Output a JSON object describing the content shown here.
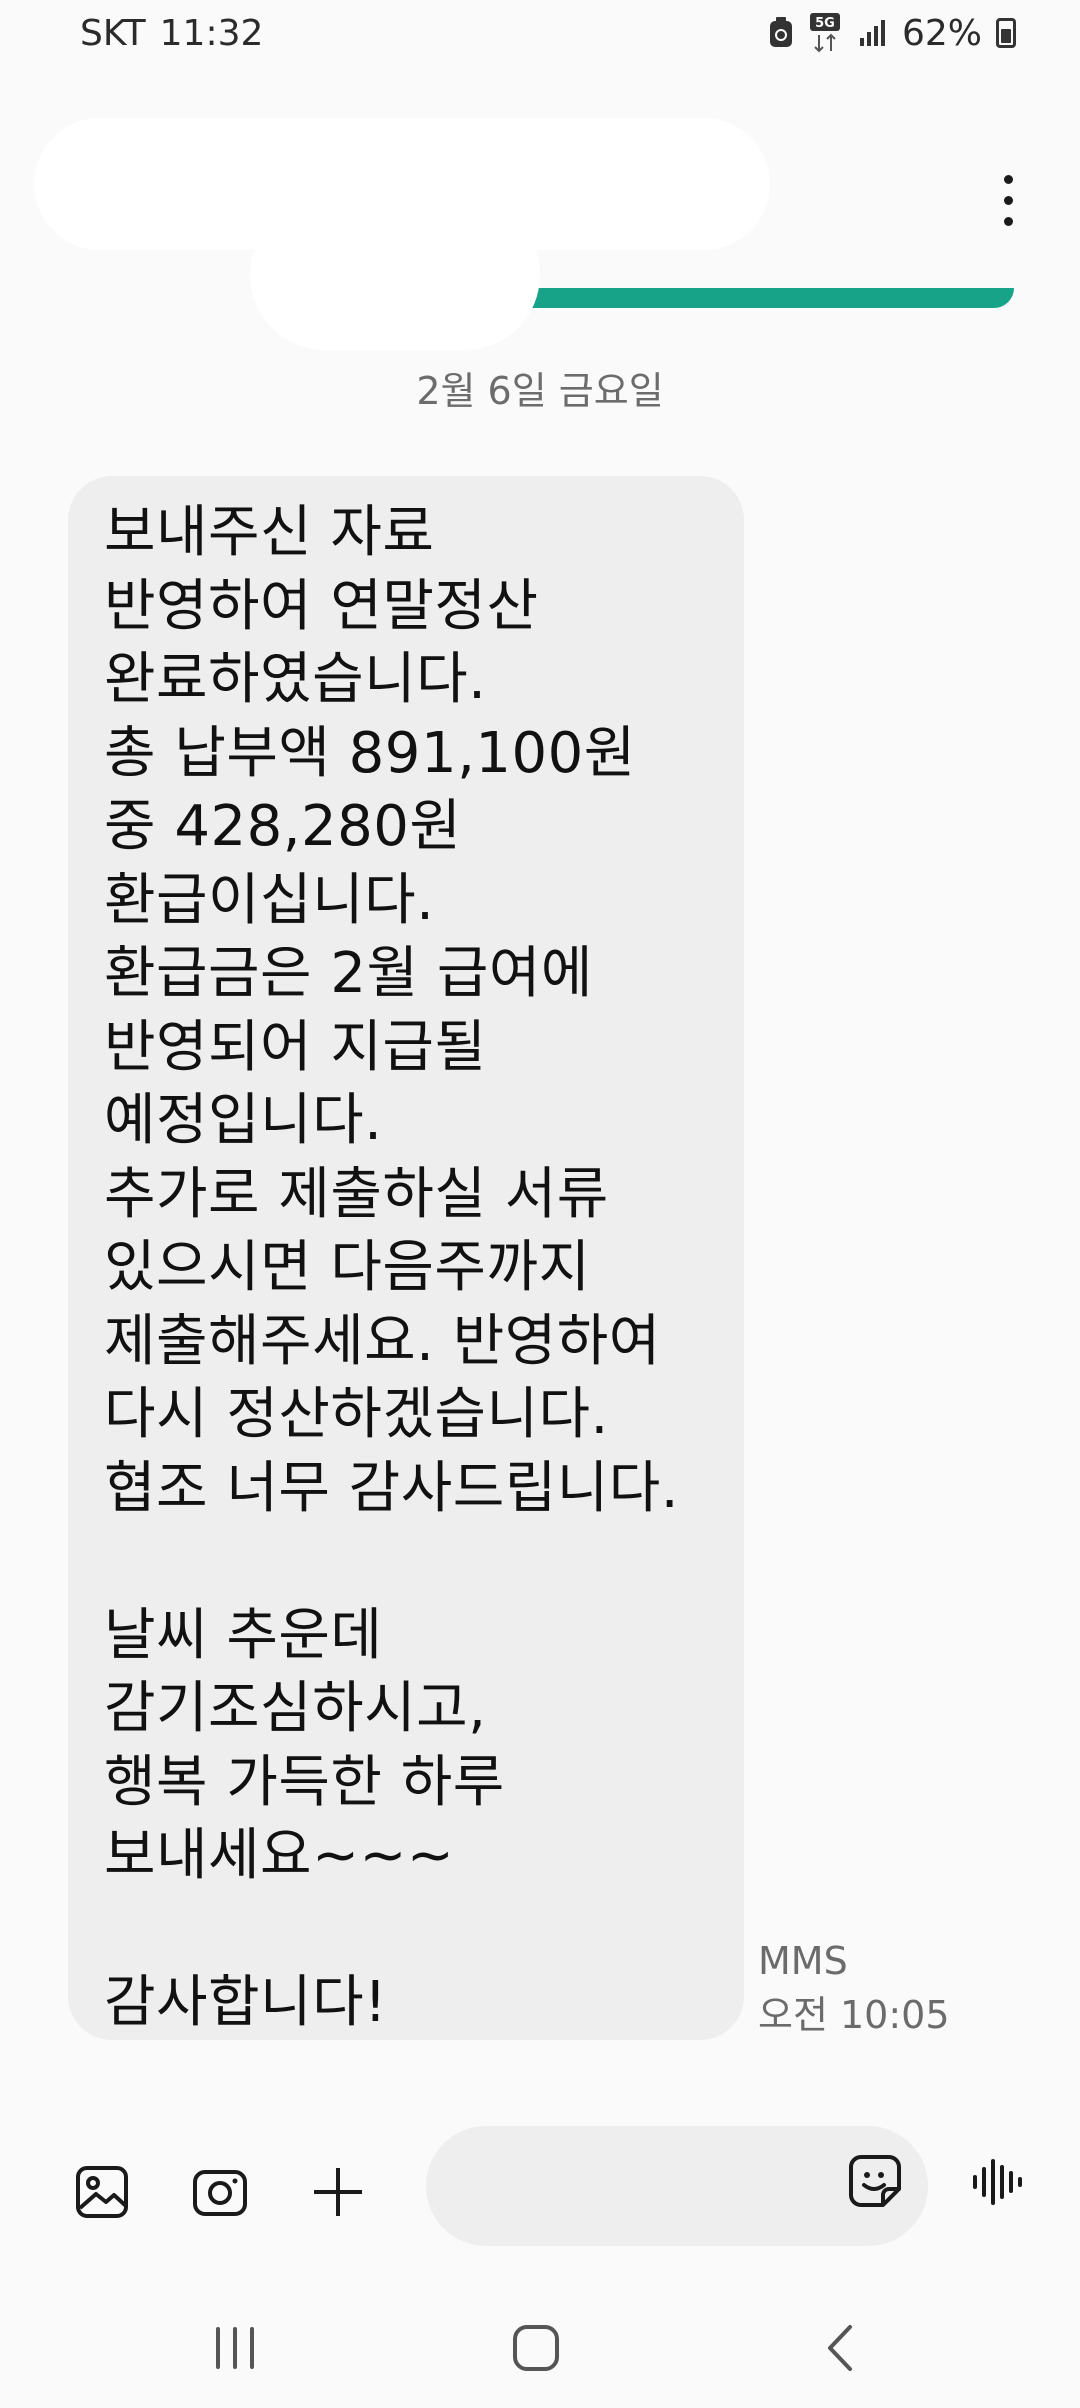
{
  "status_bar": {
    "carrier": "SKT",
    "time": "11:32",
    "network": "5G",
    "battery": "62%",
    "icons": [
      "battery-saver-icon",
      "network-5g-icon",
      "signal-icon",
      "battery-icon"
    ]
  },
  "header": {
    "accent_color": "#17a388",
    "more_icon": "more-vertical-icon"
  },
  "conversation": {
    "date_divider": "2월 6일 금요일",
    "messages": [
      {
        "lines": [
          "보내주신 자료",
          "반영하여 연말정산",
          "완료하였습니다.",
          "총 납부액 891,100원",
          "중 428,280원",
          "환급이십니다.",
          "환급금은 2월 급여에",
          "반영되어 지급될",
          "예정입니다.",
          "추가로 제출하실 서류",
          "있으시면 다음주까지",
          "제출해주세요. 반영하여",
          "다시 정산하겠습니다.",
          "협조 너무 감사드립니다.",
          "",
          "날씨 추운데",
          "감기조심하시고,",
          "행복 가득한 하루",
          "보내세요~~~",
          "",
          "감사합니다!"
        ],
        "type": "MMS",
        "time": "오전 10:05"
      }
    ]
  },
  "composer": {
    "gallery_icon": "gallery-icon",
    "camera_icon": "camera-icon",
    "add_icon": "plus-icon",
    "placeholder": "",
    "sticker_icon": "sticker-icon",
    "voice_icon": "voice-wave-icon"
  },
  "nav": {
    "recents_icon": "recents-icon",
    "home_icon": "home-icon",
    "back_icon": "back-icon"
  }
}
